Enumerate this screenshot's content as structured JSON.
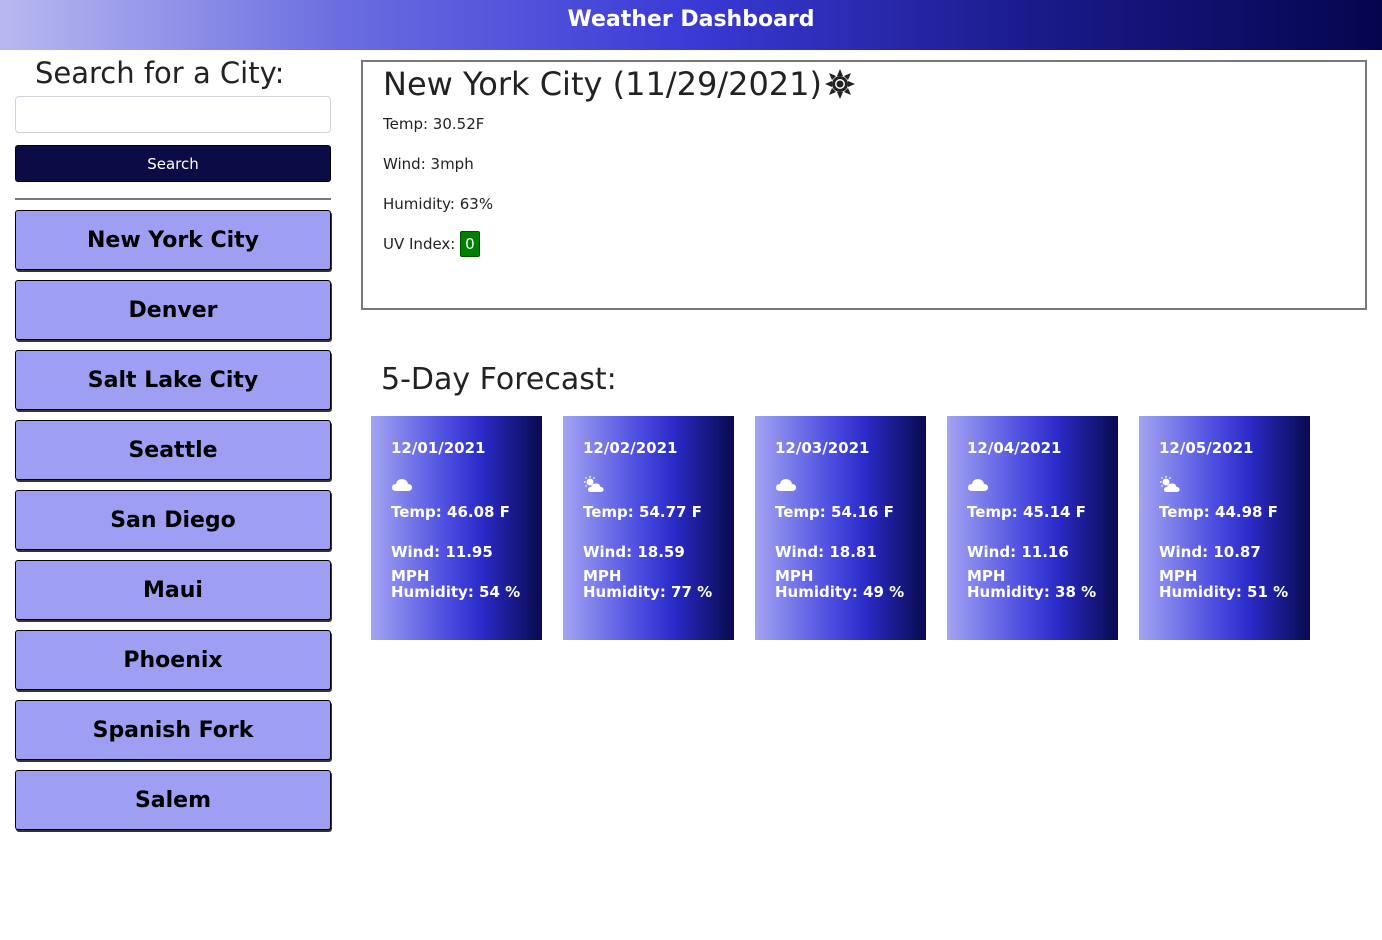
{
  "header": {
    "title": "Weather Dashboard"
  },
  "sidebar": {
    "heading": "Search for a City:",
    "search_input": {
      "value": "",
      "placeholder": ""
    },
    "search_button_label": "Search",
    "history": [
      "New York City",
      "Denver",
      "Salt Lake City",
      "Seattle",
      "San Diego",
      "Maui",
      "Phoenix",
      "Spanish Fork",
      "Salem"
    ]
  },
  "current": {
    "title": "New York City (11/29/2021)",
    "icon": "sun-icon",
    "temp": "Temp: 30.52F",
    "wind": "Wind: 3mph",
    "humidity": "Humidity: 63%",
    "uv_label": "UV Index:",
    "uv_value": "0",
    "uv_color": "#008000"
  },
  "forecast": {
    "title": "5-Day Forecast:",
    "days": [
      {
        "date": "12/01/2021",
        "icon": "cloud-icon",
        "temp": "Temp: 46.08 F",
        "wind": "Wind: 11.95 MPH",
        "humidity": "Humidity: 54 %"
      },
      {
        "date": "12/02/2021",
        "icon": "partly-cloudy-icon",
        "temp": "Temp: 54.77 F",
        "wind": "Wind: 18.59 MPH",
        "humidity": "Humidity: 77 %"
      },
      {
        "date": "12/03/2021",
        "icon": "cloud-icon",
        "temp": "Temp: 54.16 F",
        "wind": "Wind: 18.81 MPH",
        "humidity": "Humidity: 49 %"
      },
      {
        "date": "12/04/2021",
        "icon": "cloud-icon",
        "temp": "Temp: 45.14 F",
        "wind": "Wind: 11.16 MPH",
        "humidity": "Humidity: 38 %"
      },
      {
        "date": "12/05/2021",
        "icon": "partly-cloudy-icon",
        "temp": "Temp: 44.98 F",
        "wind": "Wind: 10.87 MPH",
        "humidity": "Humidity: 51 %"
      }
    ]
  },
  "colors": {
    "city_button_bg": "#9e9ff2",
    "search_button_bg": "#0b0b45",
    "header_gradient_end": "#05054e"
  }
}
